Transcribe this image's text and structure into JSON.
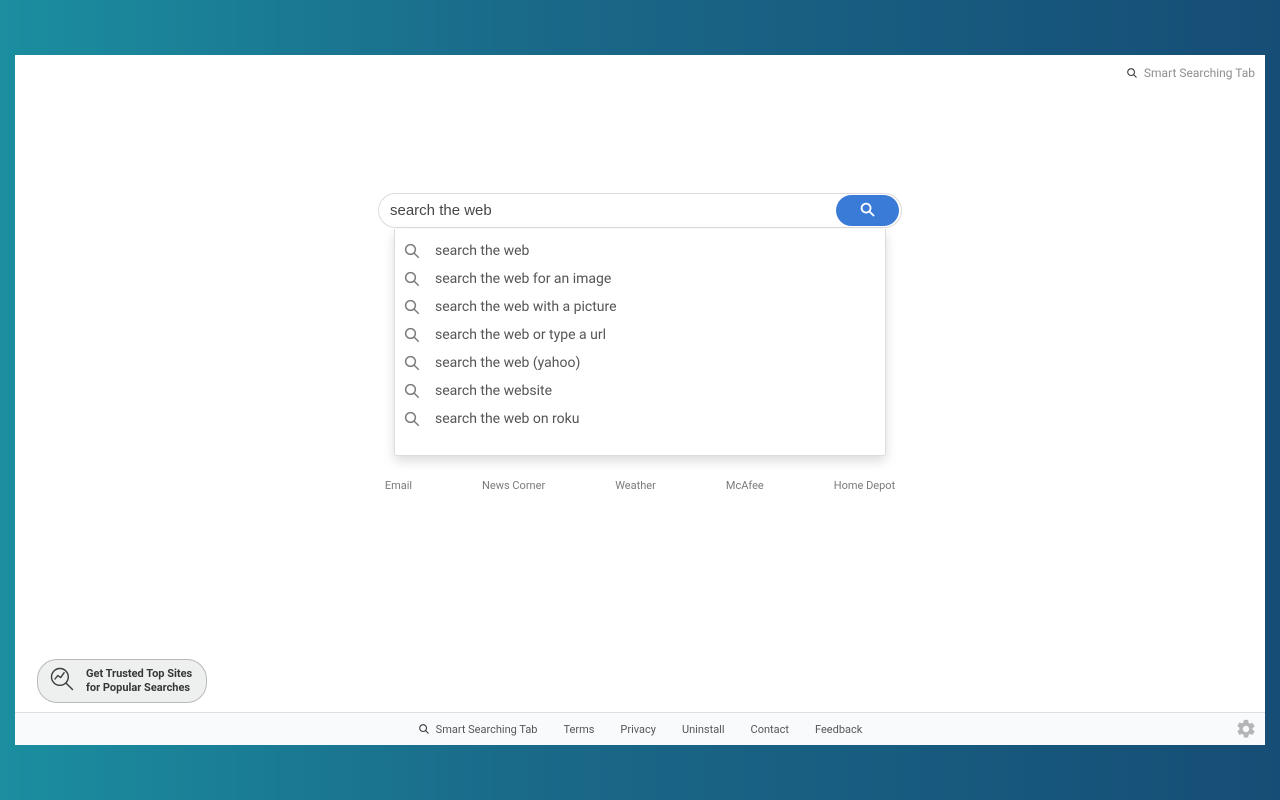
{
  "brand": "Smart Searching Tab",
  "search": {
    "value": "search the web",
    "placeholder": "search the web",
    "suggestions": [
      "search the web",
      "search the web for an image",
      "search the web with a picture",
      "search the web or type a url",
      "search the web (yahoo)",
      "search the website",
      "search the web on roku"
    ]
  },
  "quicklinks": [
    "Email",
    "News Corner",
    "Weather",
    "McAfee",
    "Home Depot"
  ],
  "bubble": {
    "line1": "Get Trusted Top Sites",
    "line2": "for Popular Searches"
  },
  "footer": {
    "brand": "Smart Searching Tab",
    "links": [
      "Terms",
      "Privacy",
      "Uninstall",
      "Contact",
      "Feedback"
    ]
  }
}
